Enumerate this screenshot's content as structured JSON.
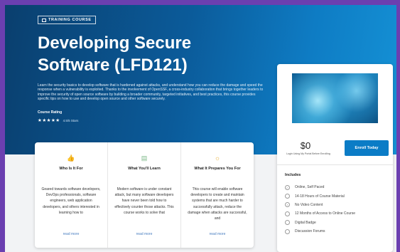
{
  "hero": {
    "badge": "TRAINING COURSE",
    "title": "Developing Secure Software (LFD121)",
    "description": "Learn the security basics to develop software that is hardened against attacks, and understand how you can reduce the damage and speed the response when a vulnerability is exploited. Thanks to the involvement of OpenSSF, a cross-industry collaboration that brings together leaders to improve the security of open source software by building a broader community, targeted initiatives, and best practices, this course provides specific tips on how to use and develop open source and other software securely.",
    "rating_label": "Course Rating",
    "stars": "★★★★★",
    "rating_count": "4.5/5 Stars"
  },
  "cards": [
    {
      "title": "Who Is It For",
      "icon": "thumbs-up-icon",
      "text": "Geared towards software developers, DevOps professionals, software engineers, web application developers, and others interested in learning how to",
      "link": "read more"
    },
    {
      "title": "What You'll Learn",
      "icon": "document-icon",
      "text": "Modern software is under constant attack, but many software developers have never been told how to effectively counter those attacks. This course works to solve that",
      "link": "read more"
    },
    {
      "title": "What It Prepares You For",
      "icon": "sun-icon",
      "text": "This course will enable software developers to create and maintain systems that are much harder to successfully attack, reduce the damage when attacks are successful, and",
      "link": "read more"
    }
  ],
  "sidebar": {
    "price": "$0",
    "price_note": "Login Using My Portal Before Enrolling",
    "enroll_label": "Enroll Today",
    "includes_title": "Includes",
    "includes": [
      {
        "label": "Online, Self Paced",
        "icon": "check-icon"
      },
      {
        "label": "14-18 Hours of Course Material",
        "icon": "clock-icon"
      },
      {
        "label": "No Video Content",
        "icon": "video-icon"
      },
      {
        "label": "12 Months of Access to Online Course",
        "icon": "calendar-icon"
      },
      {
        "label": "Digital Badge",
        "icon": "badge-icon"
      },
      {
        "label": "Discussion Forums",
        "icon": "chat-icon"
      }
    ]
  }
}
